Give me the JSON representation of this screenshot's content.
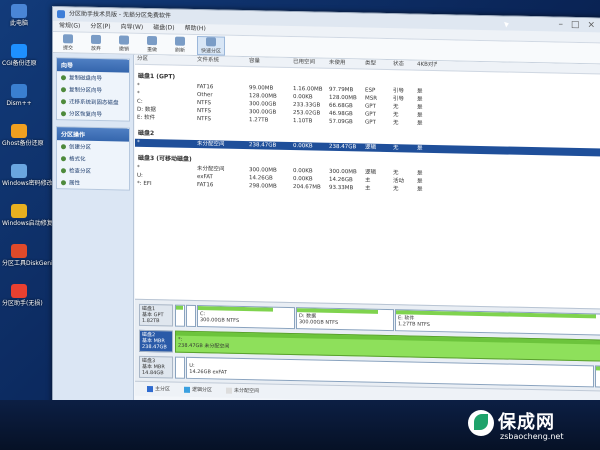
{
  "desktop": {
    "icons": [
      {
        "label": "此电脑",
        "color": "#4a86d6"
      },
      {
        "label": "CGI备份还原",
        "color": "#1e90ff"
      },
      {
        "label": "Dism++",
        "color": "#3a7fd0"
      },
      {
        "label": "Ghost备份还原",
        "color": "#f0a020"
      },
      {
        "label": "Windows密码修改",
        "color": "#6aa6e0"
      },
      {
        "label": "Windows启动修复",
        "color": "#e8b020"
      },
      {
        "label": "分区工具DiskGenius",
        "color": "#e04a2a"
      },
      {
        "label": "分区助手(无损)",
        "color": "#e84030"
      }
    ]
  },
  "window": {
    "title": "分区助手技术员版 - 无损分区免费软件",
    "menus": [
      "常规(G)",
      "分区(P)",
      "向导(W)",
      "磁盘(D)",
      "帮助(H)"
    ],
    "toolbar": [
      {
        "label": "提交",
        "active": false
      },
      {
        "label": "放弃",
        "active": false
      },
      {
        "label": "撤销",
        "active": false
      },
      {
        "label": "重做",
        "active": false
      },
      {
        "label": "刷新",
        "active": false
      },
      {
        "label": "快速分区",
        "active": true
      }
    ]
  },
  "sidebar": {
    "panels": [
      {
        "header": "向导",
        "items": [
          "复制磁盘向导",
          "复制分区向导",
          "迁移系统到固态磁盘",
          "分区恢复向导"
        ]
      },
      {
        "header": "分区操作",
        "items": [
          "创建分区",
          "格式化",
          "检查分区",
          "属性"
        ]
      }
    ]
  },
  "table": {
    "columns": [
      "分区",
      "文件系统",
      "容量",
      "已用空间",
      "未使用",
      "类型",
      "状态",
      "4KB对齐"
    ],
    "disks": [
      {
        "header": "磁盘1 (GPT)",
        "rows": [
          {
            "name": "*",
            "fs": "FAT16",
            "cap": "99.00MB",
            "used": "1.16.00MB",
            "free": "97.79MB",
            "type": "ESP",
            "status": "引导",
            "align": "是",
            "sel": false
          },
          {
            "name": "*",
            "fs": "Other",
            "cap": "128.00MB",
            "used": "0.00KB",
            "free": "128.00MB",
            "type": "MSR",
            "status": "引导",
            "align": "是",
            "sel": false
          },
          {
            "name": "C:",
            "fs": "NTFS",
            "cap": "300.00GB",
            "used": "233.33GB",
            "free": "66.68GB",
            "type": "GPT",
            "status": "无",
            "align": "是",
            "sel": false
          },
          {
            "name": "D: 数据",
            "fs": "NTFS",
            "cap": "300.00GB",
            "used": "253.02GB",
            "free": "46.98GB",
            "type": "GPT",
            "status": "无",
            "align": "是",
            "sel": false
          },
          {
            "name": "E: 软件",
            "fs": "NTFS",
            "cap": "1.27TB",
            "used": "1.10TB",
            "free": "57.09GB",
            "type": "GPT",
            "status": "无",
            "align": "是",
            "sel": false
          }
        ]
      },
      {
        "header": "磁盘2",
        "rows": [
          {
            "name": "*",
            "fs": "未分配空间",
            "cap": "238.47GB",
            "used": "0.00KB",
            "free": "238.47GB",
            "type": "逻辑",
            "status": "无",
            "align": "是",
            "sel": true
          }
        ]
      },
      {
        "header": "磁盘3 (可移动磁盘)",
        "rows": [
          {
            "name": "*",
            "fs": "未分配空间",
            "cap": "300.00MB",
            "used": "0.00KB",
            "free": "300.00MB",
            "type": "逻辑",
            "status": "无",
            "align": "是",
            "sel": false
          },
          {
            "name": "U:",
            "fs": "exFAT",
            "cap": "14.26GB",
            "used": "0.00KB",
            "free": "14.26GB",
            "type": "主",
            "status": "活动",
            "align": "是",
            "sel": false
          },
          {
            "name": "*: EFI",
            "fs": "FAT16",
            "cap": "298.00MB",
            "used": "204.67MB",
            "free": "93.33MB",
            "type": "主",
            "status": "无",
            "align": "是",
            "sel": false
          }
        ]
      }
    ]
  },
  "diskmap": [
    {
      "info": [
        "磁盘1",
        "基本 GPT",
        "1.82TB"
      ],
      "sel": false,
      "parts": [
        {
          "label": "",
          "sub": "",
          "fill": 0.9,
          "flex": 1,
          "unalloc": false
        },
        {
          "label": "",
          "sub": "",
          "fill": 0.0,
          "flex": 1,
          "unalloc": false
        },
        {
          "label": "C:",
          "sub": "300.00GB NTFS",
          "fill": 0.78,
          "flex": 12,
          "unalloc": false
        },
        {
          "label": "D: 数据",
          "sub": "300.00GB NTFS",
          "fill": 0.84,
          "flex": 12,
          "unalloc": false
        },
        {
          "label": "E: 软件",
          "sub": "1.27TB NTFS",
          "fill": 0.96,
          "flex": 26,
          "unalloc": false
        }
      ]
    },
    {
      "info": [
        "磁盘2",
        "基本 MBR",
        "238.47GB"
      ],
      "sel": true,
      "parts": [
        {
          "label": "*:",
          "sub": "238.47GB 未分配空间",
          "fill": 1.0,
          "flex": 52,
          "unalloc": true
        }
      ]
    },
    {
      "info": [
        "磁盘3",
        "基本 MBR",
        "14.84GB"
      ],
      "sel": false,
      "parts": [
        {
          "label": "",
          "sub": "",
          "fill": 0.0,
          "flex": 1,
          "unalloc": false
        },
        {
          "label": "U:",
          "sub": "14.26GB exFAT",
          "fill": 0.0,
          "flex": 49,
          "unalloc": false
        },
        {
          "label": "",
          "sub": "",
          "fill": 0.7,
          "flex": 1,
          "unalloc": false
        }
      ]
    }
  ],
  "legend": [
    {
      "label": "主分区",
      "color": "#2f6bd0"
    },
    {
      "label": "逻辑分区",
      "color": "#3aa0e0"
    },
    {
      "label": "未分配空间",
      "color": "#dddddd"
    }
  ],
  "watermark": {
    "title": "保成网",
    "url": "zsbaocheng.net"
  }
}
